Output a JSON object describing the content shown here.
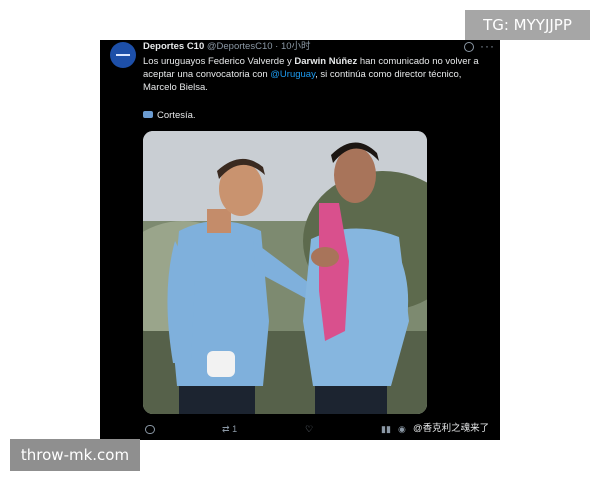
{
  "overlay": {
    "tg_badge": "TG: MYYJJPP",
    "footer_badge": "throw-mk.com"
  },
  "tweet": {
    "display_name": "Deportes C10",
    "handle": "@DeportesC10",
    "separator": " · ",
    "time": "10小时",
    "text": {
      "part1": "Los uruguayos Federico Valverde y ",
      "bold_name": "Darwin Núñez",
      "part2": " han comunicado no volver a aceptar una convocatoria con ",
      "mention": "@Uruguay",
      "part3": ", si continúa como director técnico, Marcelo Bielsa."
    },
    "courtesy": "Cortesía.",
    "actions": {
      "retweet_count": "1",
      "weibo_watermark": "@香克利之魂来了"
    }
  },
  "colors": {
    "tweet_bg": "#000000",
    "mention": "#1d9bf0",
    "text": "#e7e9ea",
    "muted": "#8b98a5",
    "jersey": "#7fb0dc"
  },
  "icons": [
    "grok-icon",
    "more-icon",
    "camera-icon",
    "reply-icon",
    "retweet-icon",
    "like-icon",
    "views-icon",
    "weibo-icon"
  ]
}
